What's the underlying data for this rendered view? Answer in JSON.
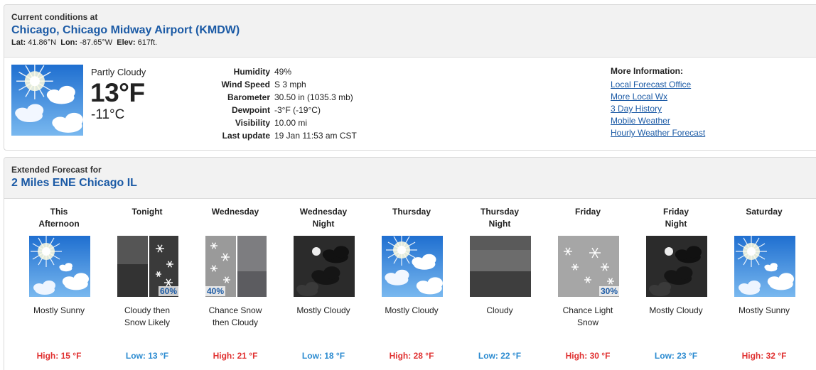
{
  "current": {
    "label": "Current conditions at",
    "station": "Chicago, Chicago Midway Airport (KMDW)",
    "lat_label": "Lat:",
    "lat": "41.86°N",
    "lon_label": "Lon:",
    "lon": "-87.65°W",
    "elev_label": "Elev:",
    "elev": "617ft.",
    "condition": "Partly Cloudy",
    "temp_f": "13°F",
    "temp_c": "-11°C",
    "icon": "partly-cloudy",
    "details": [
      {
        "key": "Humidity",
        "value": "49%"
      },
      {
        "key": "Wind Speed",
        "value": "S 3 mph"
      },
      {
        "key": "Barometer",
        "value": "30.50 in (1035.3 mb)"
      },
      {
        "key": "Dewpoint",
        "value": "-3°F (-19°C)"
      },
      {
        "key": "Visibility",
        "value": "10.00 mi"
      },
      {
        "key": "Last update",
        "value": "19 Jan 11:53 am CST"
      }
    ],
    "more_title": "More Information:",
    "links": [
      "Local Forecast Office",
      "More Local Wx",
      "3 Day History",
      "Mobile Weather",
      "Hourly Weather Forecast"
    ]
  },
  "extended": {
    "label": "Extended Forecast for",
    "location": "2 Miles ENE Chicago IL",
    "periods": [
      {
        "name1": "This",
        "name2": "Afternoon",
        "icon": "sunny",
        "pop": "",
        "desc1": "Mostly Sunny",
        "desc2": "",
        "temp": "High: 15 °F",
        "kind": "high"
      },
      {
        "name1": "Tonight",
        "name2": "",
        "icon": "cloudy-then-snow",
        "pop": "60%",
        "pop_side": "right",
        "desc1": "Cloudy then",
        "desc2": "Snow Likely",
        "temp": "Low: 13 °F",
        "kind": "low"
      },
      {
        "name1": "Wednesday",
        "name2": "",
        "icon": "snow-then-cloudy",
        "pop": "40%",
        "pop_side": "left",
        "desc1": "Chance Snow",
        "desc2": "then Cloudy",
        "temp": "High: 21 °F",
        "kind": "high"
      },
      {
        "name1": "Wednesday",
        "name2": "Night",
        "icon": "night-cloudy",
        "pop": "",
        "desc1": "Mostly Cloudy",
        "desc2": "",
        "temp": "Low: 18 °F",
        "kind": "low"
      },
      {
        "name1": "Thursday",
        "name2": "",
        "icon": "partly-cloudy",
        "pop": "",
        "desc1": "Mostly Cloudy",
        "desc2": "",
        "temp": "High: 28 °F",
        "kind": "high"
      },
      {
        "name1": "Thursday",
        "name2": "Night",
        "icon": "overcast",
        "pop": "",
        "desc1": "Cloudy",
        "desc2": "",
        "temp": "Low: 22 °F",
        "kind": "low"
      },
      {
        "name1": "Friday",
        "name2": "",
        "icon": "light-snow",
        "pop": "30%",
        "pop_side": "right",
        "desc1": "Chance Light",
        "desc2": "Snow",
        "temp": "High: 30 °F",
        "kind": "high"
      },
      {
        "name1": "Friday",
        "name2": "Night",
        "icon": "night-cloudy",
        "pop": "",
        "desc1": "Mostly Cloudy",
        "desc2": "",
        "temp": "Low: 23 °F",
        "kind": "low"
      },
      {
        "name1": "Saturday",
        "name2": "",
        "icon": "sunny",
        "pop": "",
        "desc1": "Mostly Sunny",
        "desc2": "",
        "temp": "High: 32 °F",
        "kind": "high"
      }
    ]
  },
  "colors": {
    "link": "#1b5aa5",
    "high": "#e03030",
    "low": "#2a8ad0"
  }
}
